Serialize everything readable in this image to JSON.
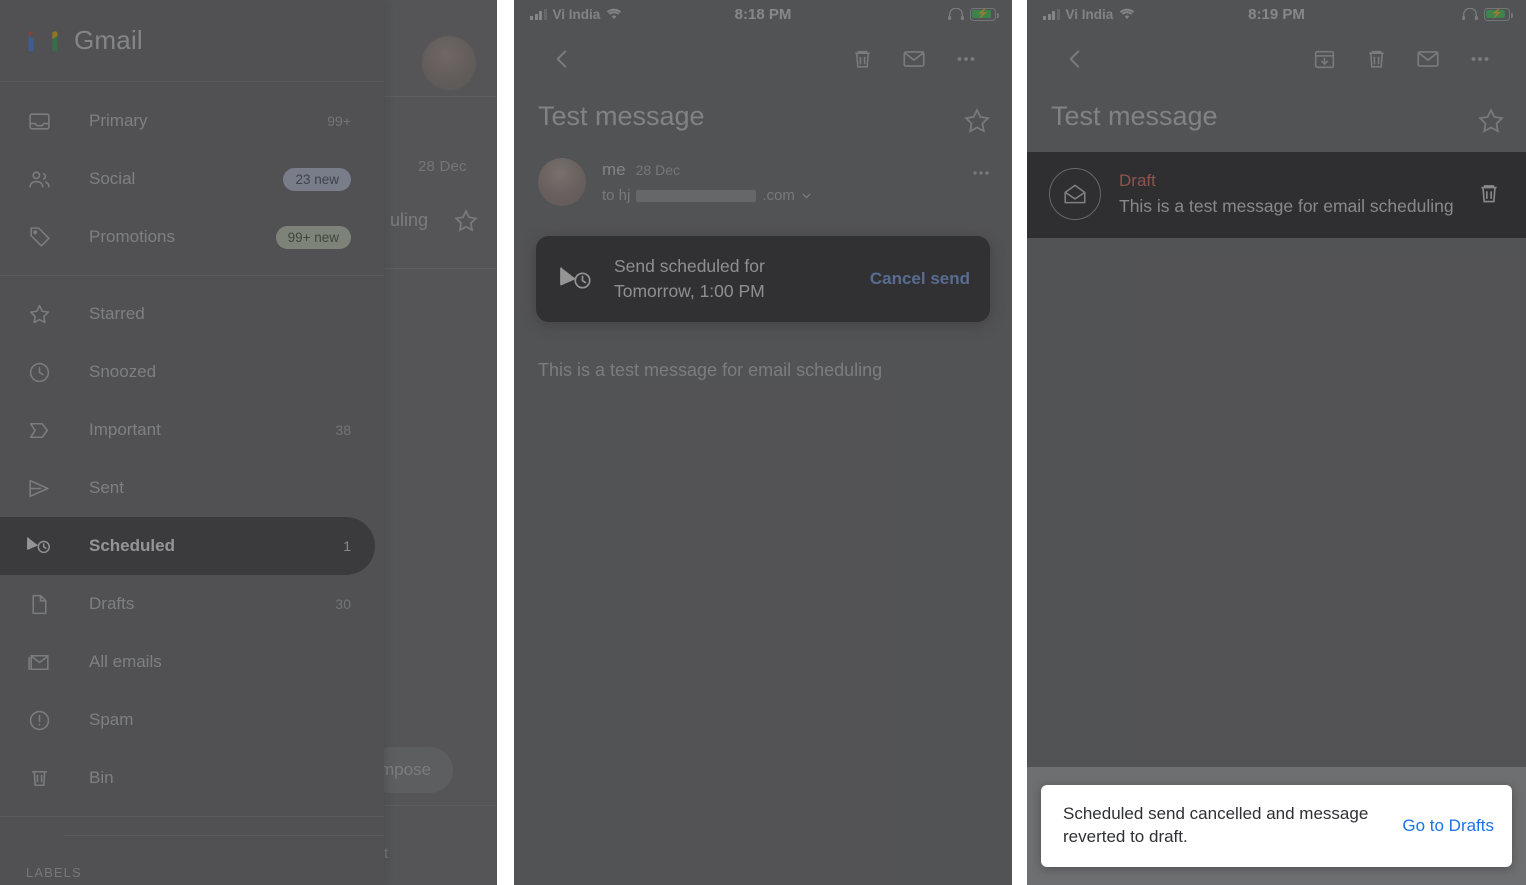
{
  "app": {
    "name": "Gmail"
  },
  "panel1": {
    "drawer": {
      "brand": "Gmail",
      "items": [
        {
          "label": "Primary",
          "count": "99+",
          "icon": "inbox-icon",
          "badge": null,
          "selected": false
        },
        {
          "label": "Social",
          "count": null,
          "icon": "people-icon",
          "badge": "23 new",
          "badge_style": "social",
          "selected": false
        },
        {
          "label": "Promotions",
          "count": null,
          "icon": "tag-icon",
          "badge": "99+ new",
          "badge_style": "promo",
          "selected": false
        },
        {
          "label": "Starred",
          "count": null,
          "icon": "star-icon",
          "badge": null,
          "selected": false
        },
        {
          "label": "Snoozed",
          "count": null,
          "icon": "clock-icon",
          "badge": null,
          "selected": false
        },
        {
          "label": "Important",
          "count": "38",
          "icon": "important-icon",
          "badge": null,
          "selected": false
        },
        {
          "label": "Sent",
          "count": null,
          "icon": "send-icon",
          "badge": null,
          "selected": false
        },
        {
          "label": "Scheduled",
          "count": "1",
          "icon": "scheduled-send-icon",
          "badge": null,
          "selected": true
        },
        {
          "label": "Drafts",
          "count": "30",
          "icon": "draft-file-icon",
          "badge": null,
          "selected": false
        },
        {
          "label": "All emails",
          "count": null,
          "icon": "all-mail-icon",
          "badge": null,
          "selected": false
        },
        {
          "label": "Spam",
          "count": null,
          "icon": "spam-icon",
          "badge": null,
          "selected": false
        },
        {
          "label": "Bin",
          "count": null,
          "icon": "trash-icon",
          "badge": null,
          "selected": false
        }
      ],
      "labels_header": "LABELS"
    },
    "background_list": {
      "date": "28 Dec",
      "subject_fragment": "uling",
      "compose_label": "mpose",
      "bottom_fragment": "t"
    },
    "colors": {
      "badge_social": "#c3cbe4",
      "badge_promo": "#cfd9c4",
      "selected_pill": "#3b3b3c"
    }
  },
  "panel2": {
    "statusbar": {
      "carrier": "Vi India",
      "time": "8:18 PM"
    },
    "toolbar": {
      "back": "Back",
      "delete": "Delete",
      "mark_unread": "Mark unread",
      "more": "More options"
    },
    "subject": "Test message",
    "star": "Star",
    "sender": {
      "name": "me",
      "date": "28 Dec",
      "to_prefix": "to hj",
      "to_suffix": ".com",
      "more": "More"
    },
    "toast": {
      "icon": "scheduled-send-icon",
      "line1": "Send scheduled for",
      "line2": "Tomorrow, 1:00 PM",
      "action": "Cancel send"
    },
    "body": "This is a test message for email scheduling"
  },
  "panel3": {
    "statusbar": {
      "carrier": "Vi India",
      "time": "8:19 PM"
    },
    "toolbar": {
      "back": "Back",
      "archive": "Archive",
      "delete": "Delete",
      "mark_unread": "Mark unread",
      "more": "More options"
    },
    "subject": "Test message",
    "star": "Star",
    "draft": {
      "label": "Draft",
      "snippet": "This is a test message for email scheduling",
      "delete": "Delete draft"
    },
    "snackbar": {
      "text": "Scheduled send cancelled and message reverted to draft.",
      "action": "Go to Drafts"
    },
    "colors": {
      "draft_label": "#ef6f63",
      "snackbar_action": "#1a73e8",
      "draft_row_bg": "#1f2023"
    }
  }
}
